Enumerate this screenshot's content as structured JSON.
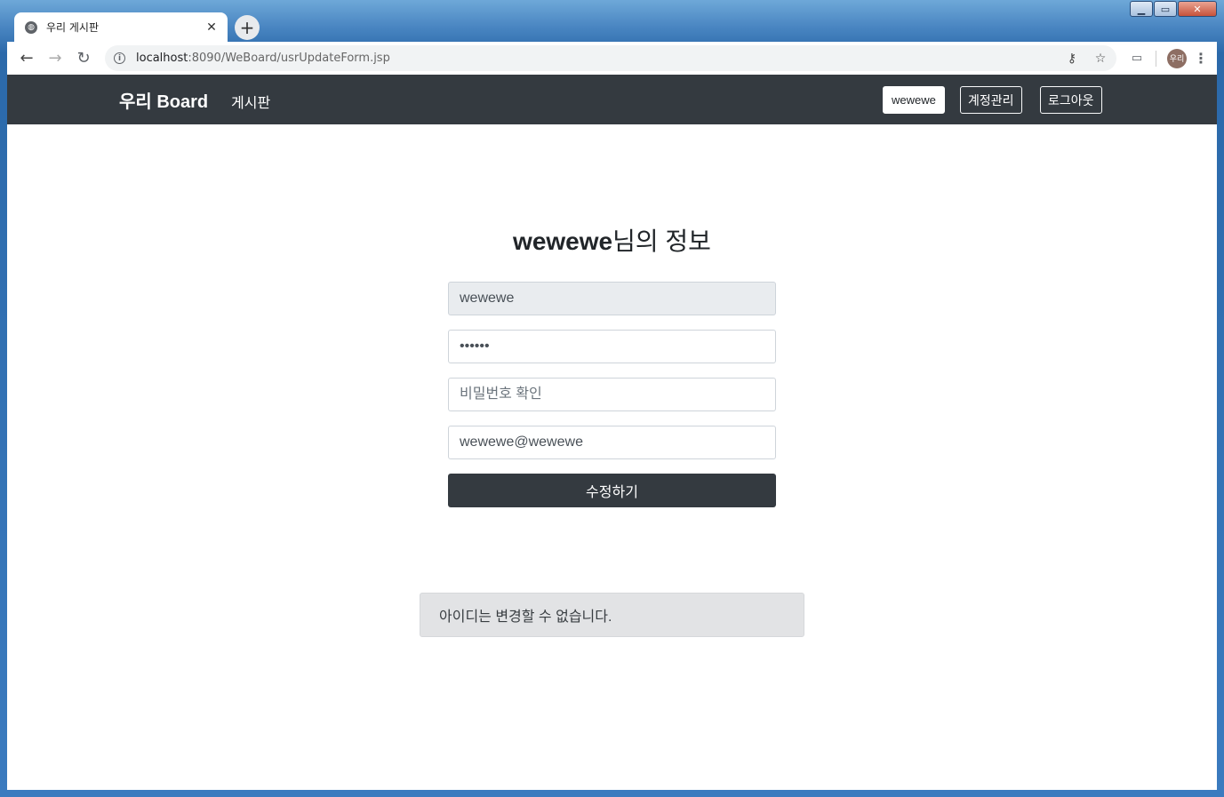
{
  "browser": {
    "tab_title": "우리 게시판",
    "tab_close": "✕",
    "new_tab": "+",
    "url_host": "localhost",
    "url_path": ":8090/WeBoard/usrUpdateForm.jsp",
    "profile_label": "우리"
  },
  "navbar": {
    "brand": "우리 Board",
    "board_link": "게시판",
    "user_button": "wewewe",
    "account_button": "계정관리",
    "logout_button": "로그아웃"
  },
  "form": {
    "title_user": "wewewe",
    "title_suffix": "님의 정보",
    "id_value": "wewewe",
    "password_value": "wewewe",
    "password_confirm_placeholder": "비밀번호 확인",
    "email_value": "wewewe@wewewe",
    "submit_label": "수정하기"
  },
  "alert": {
    "message": "아이디는 변경할 수 없습니다."
  },
  "colors": {
    "navbar_bg": "#343a40",
    "submit_bg": "#343a40",
    "alert_bg": "#e2e3e5"
  }
}
